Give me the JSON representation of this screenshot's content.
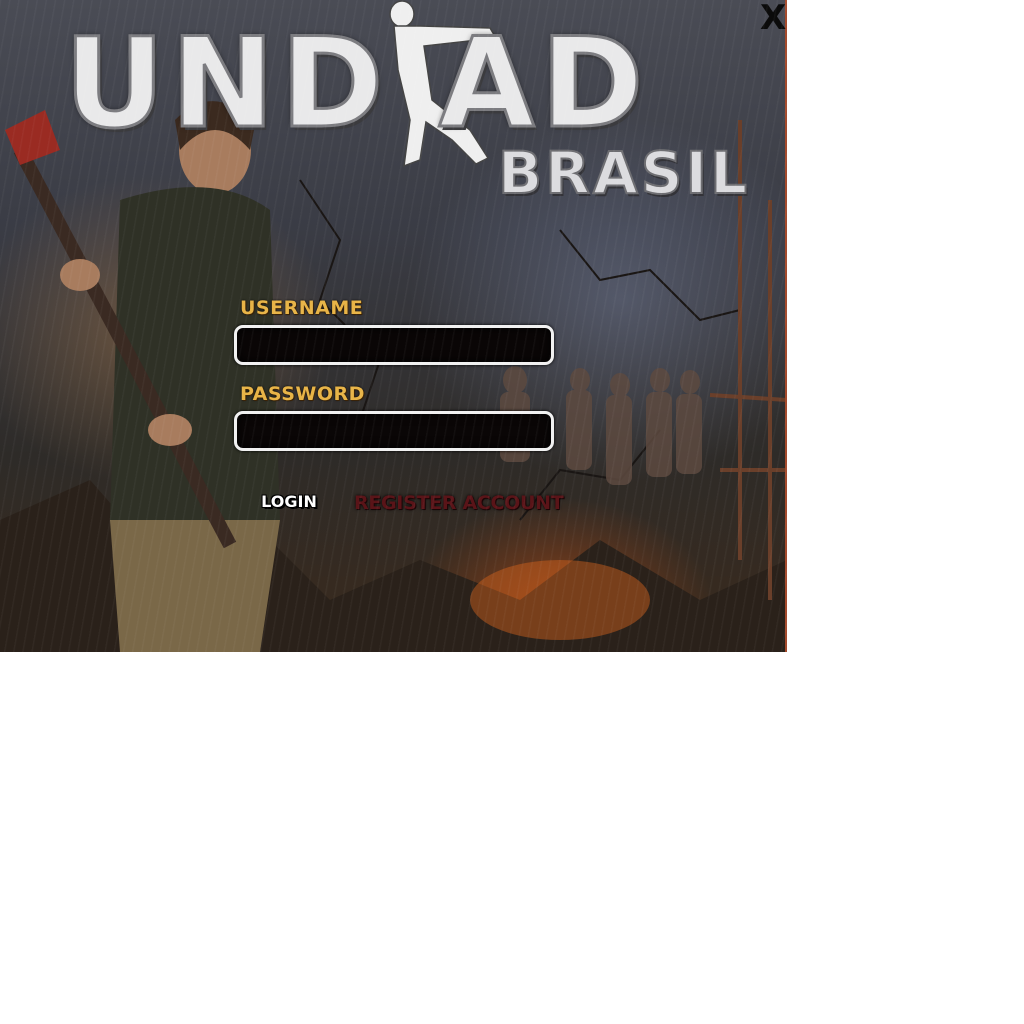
{
  "window": {
    "close_label": "X"
  },
  "logo": {
    "title": "UNDEAD",
    "subtitle": "BRASIL",
    "title_display": "UND AD"
  },
  "login_form": {
    "username_label": "USERNAME",
    "username_value": "",
    "password_label": "PASSWORD",
    "password_value": "",
    "login_label": "LOGIN",
    "register_label": "REGISTER ACCOUNT"
  },
  "colors": {
    "label_gold": "#e8b447",
    "register_red": "#5a1418",
    "field_border": "#f1f1f1",
    "field_bg": "#0a0606",
    "accent_edge": "#a34a2c"
  },
  "icons": {
    "logo_figure": "zombie-silhouette-icon",
    "survivor_art": "survivor-with-axe",
    "close": "close-icon"
  }
}
